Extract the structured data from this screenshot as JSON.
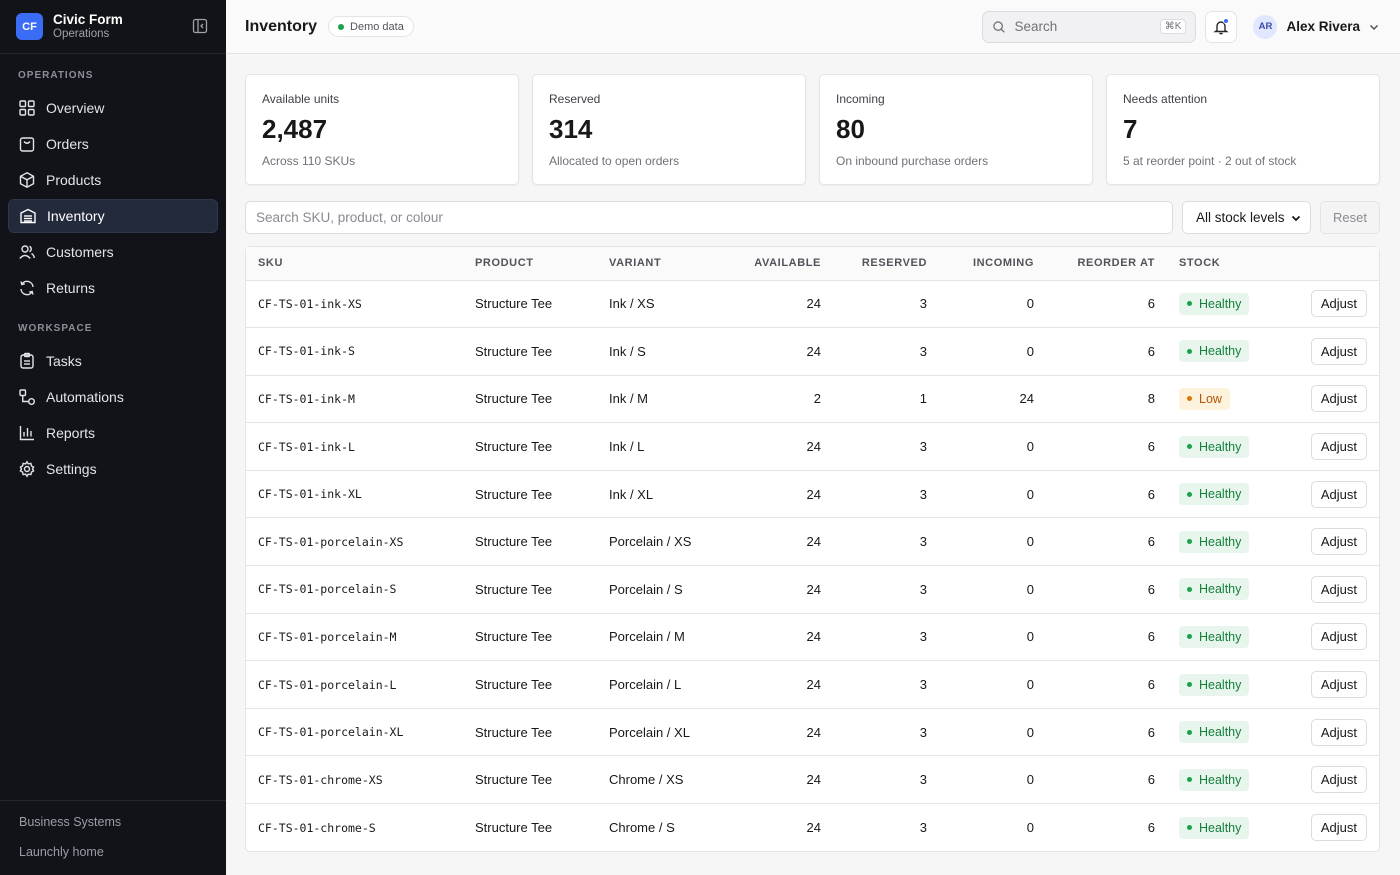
{
  "brand": {
    "logo": "CF",
    "name": "Civic Form",
    "subtitle": "Operations"
  },
  "sidebar": {
    "sections": [
      {
        "label": "OPERATIONS",
        "items": [
          {
            "label": "Overview",
            "icon": "grid-icon"
          },
          {
            "label": "Orders",
            "icon": "bag-icon"
          },
          {
            "label": "Products",
            "icon": "box-icon"
          },
          {
            "label": "Inventory",
            "icon": "warehouse-icon",
            "active": true
          },
          {
            "label": "Customers",
            "icon": "users-icon"
          },
          {
            "label": "Returns",
            "icon": "refresh-icon"
          }
        ]
      },
      {
        "label": "WORKSPACE",
        "items": [
          {
            "label": "Tasks",
            "icon": "clipboard-icon"
          },
          {
            "label": "Automations",
            "icon": "workflow-icon"
          },
          {
            "label": "Reports",
            "icon": "bar-chart-icon"
          },
          {
            "label": "Settings",
            "icon": "gear-icon"
          }
        ]
      }
    ],
    "footer": [
      "Business Systems",
      "Launchly home"
    ]
  },
  "header": {
    "title": "Inventory",
    "badge": "Demo data",
    "search_placeholder": "Search",
    "shortcut": "⌘K",
    "user_initials": "AR",
    "user_name": "Alex Rivera"
  },
  "stats": [
    {
      "label": "Available units",
      "value": "2,487",
      "note": "Across 110 SKUs"
    },
    {
      "label": "Reserved",
      "value": "314",
      "note": "Allocated to open orders"
    },
    {
      "label": "Incoming",
      "value": "80",
      "note": "On inbound purchase orders"
    },
    {
      "label": "Needs attention",
      "value": "7",
      "note": "5 at reorder point · 2 out of stock"
    }
  ],
  "filters": {
    "search_placeholder": "Search SKU, product, or colour",
    "stock_level": "All stock levels",
    "reset_label": "Reset"
  },
  "table": {
    "columns": [
      "SKU",
      "PRODUCT",
      "VARIANT",
      "AVAILABLE",
      "RESERVED",
      "INCOMING",
      "REORDER AT",
      "STOCK"
    ],
    "action_label": "Adjust",
    "rows": [
      {
        "sku": "CF-TS-01-ink-XS",
        "product": "Structure Tee",
        "variant": "Ink / XS",
        "available": "24",
        "reserved": "3",
        "incoming": "0",
        "reorder": "6",
        "stock": "Healthy",
        "status": "healthy"
      },
      {
        "sku": "CF-TS-01-ink-S",
        "product": "Structure Tee",
        "variant": "Ink / S",
        "available": "24",
        "reserved": "3",
        "incoming": "0",
        "reorder": "6",
        "stock": "Healthy",
        "status": "healthy"
      },
      {
        "sku": "CF-TS-01-ink-M",
        "product": "Structure Tee",
        "variant": "Ink / M",
        "available": "2",
        "reserved": "1",
        "incoming": "24",
        "reorder": "8",
        "stock": "Low",
        "status": "low"
      },
      {
        "sku": "CF-TS-01-ink-L",
        "product": "Structure Tee",
        "variant": "Ink / L",
        "available": "24",
        "reserved": "3",
        "incoming": "0",
        "reorder": "6",
        "stock": "Healthy",
        "status": "healthy"
      },
      {
        "sku": "CF-TS-01-ink-XL",
        "product": "Structure Tee",
        "variant": "Ink / XL",
        "available": "24",
        "reserved": "3",
        "incoming": "0",
        "reorder": "6",
        "stock": "Healthy",
        "status": "healthy"
      },
      {
        "sku": "CF-TS-01-porcelain-XS",
        "product": "Structure Tee",
        "variant": "Porcelain / XS",
        "available": "24",
        "reserved": "3",
        "incoming": "0",
        "reorder": "6",
        "stock": "Healthy",
        "status": "healthy"
      },
      {
        "sku": "CF-TS-01-porcelain-S",
        "product": "Structure Tee",
        "variant": "Porcelain / S",
        "available": "24",
        "reserved": "3",
        "incoming": "0",
        "reorder": "6",
        "stock": "Healthy",
        "status": "healthy"
      },
      {
        "sku": "CF-TS-01-porcelain-M",
        "product": "Structure Tee",
        "variant": "Porcelain / M",
        "available": "24",
        "reserved": "3",
        "incoming": "0",
        "reorder": "6",
        "stock": "Healthy",
        "status": "healthy"
      },
      {
        "sku": "CF-TS-01-porcelain-L",
        "product": "Structure Tee",
        "variant": "Porcelain / L",
        "available": "24",
        "reserved": "3",
        "incoming": "0",
        "reorder": "6",
        "stock": "Healthy",
        "status": "healthy"
      },
      {
        "sku": "CF-TS-01-porcelain-XL",
        "product": "Structure Tee",
        "variant": "Porcelain / XL",
        "available": "24",
        "reserved": "3",
        "incoming": "0",
        "reorder": "6",
        "stock": "Healthy",
        "status": "healthy"
      },
      {
        "sku": "CF-TS-01-chrome-XS",
        "product": "Structure Tee",
        "variant": "Chrome / XS",
        "available": "24",
        "reserved": "3",
        "incoming": "0",
        "reorder": "6",
        "stock": "Healthy",
        "status": "healthy"
      },
      {
        "sku": "CF-TS-01-chrome-S",
        "product": "Structure Tee",
        "variant": "Chrome / S",
        "available": "24",
        "reserved": "3",
        "incoming": "0",
        "reorder": "6",
        "stock": "Healthy",
        "status": "healthy"
      }
    ]
  },
  "colors": {
    "accent": "#3b6cf6",
    "sidebar_bg": "#111318",
    "healthy": "#16a34a",
    "low": "#d97706"
  }
}
